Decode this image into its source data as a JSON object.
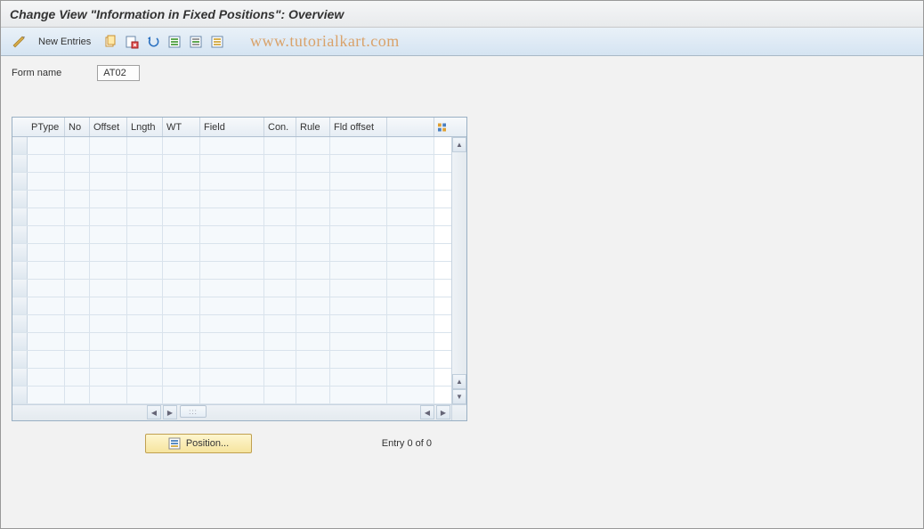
{
  "title": "Change View \"Information in Fixed Positions\": Overview",
  "toolbar": {
    "new_entries_label": "New Entries"
  },
  "watermark": "www.tutorialkart.com",
  "form": {
    "name_label": "Form name",
    "name_value": "AT02"
  },
  "table": {
    "columns": [
      "PType",
      "No",
      "Offset",
      "Lngth",
      "WT",
      "Field",
      "Con.",
      "Rule",
      "Fld offset"
    ],
    "rows": []
  },
  "footer": {
    "position_label": "Position...",
    "entry_label": "Entry 0 of 0"
  }
}
